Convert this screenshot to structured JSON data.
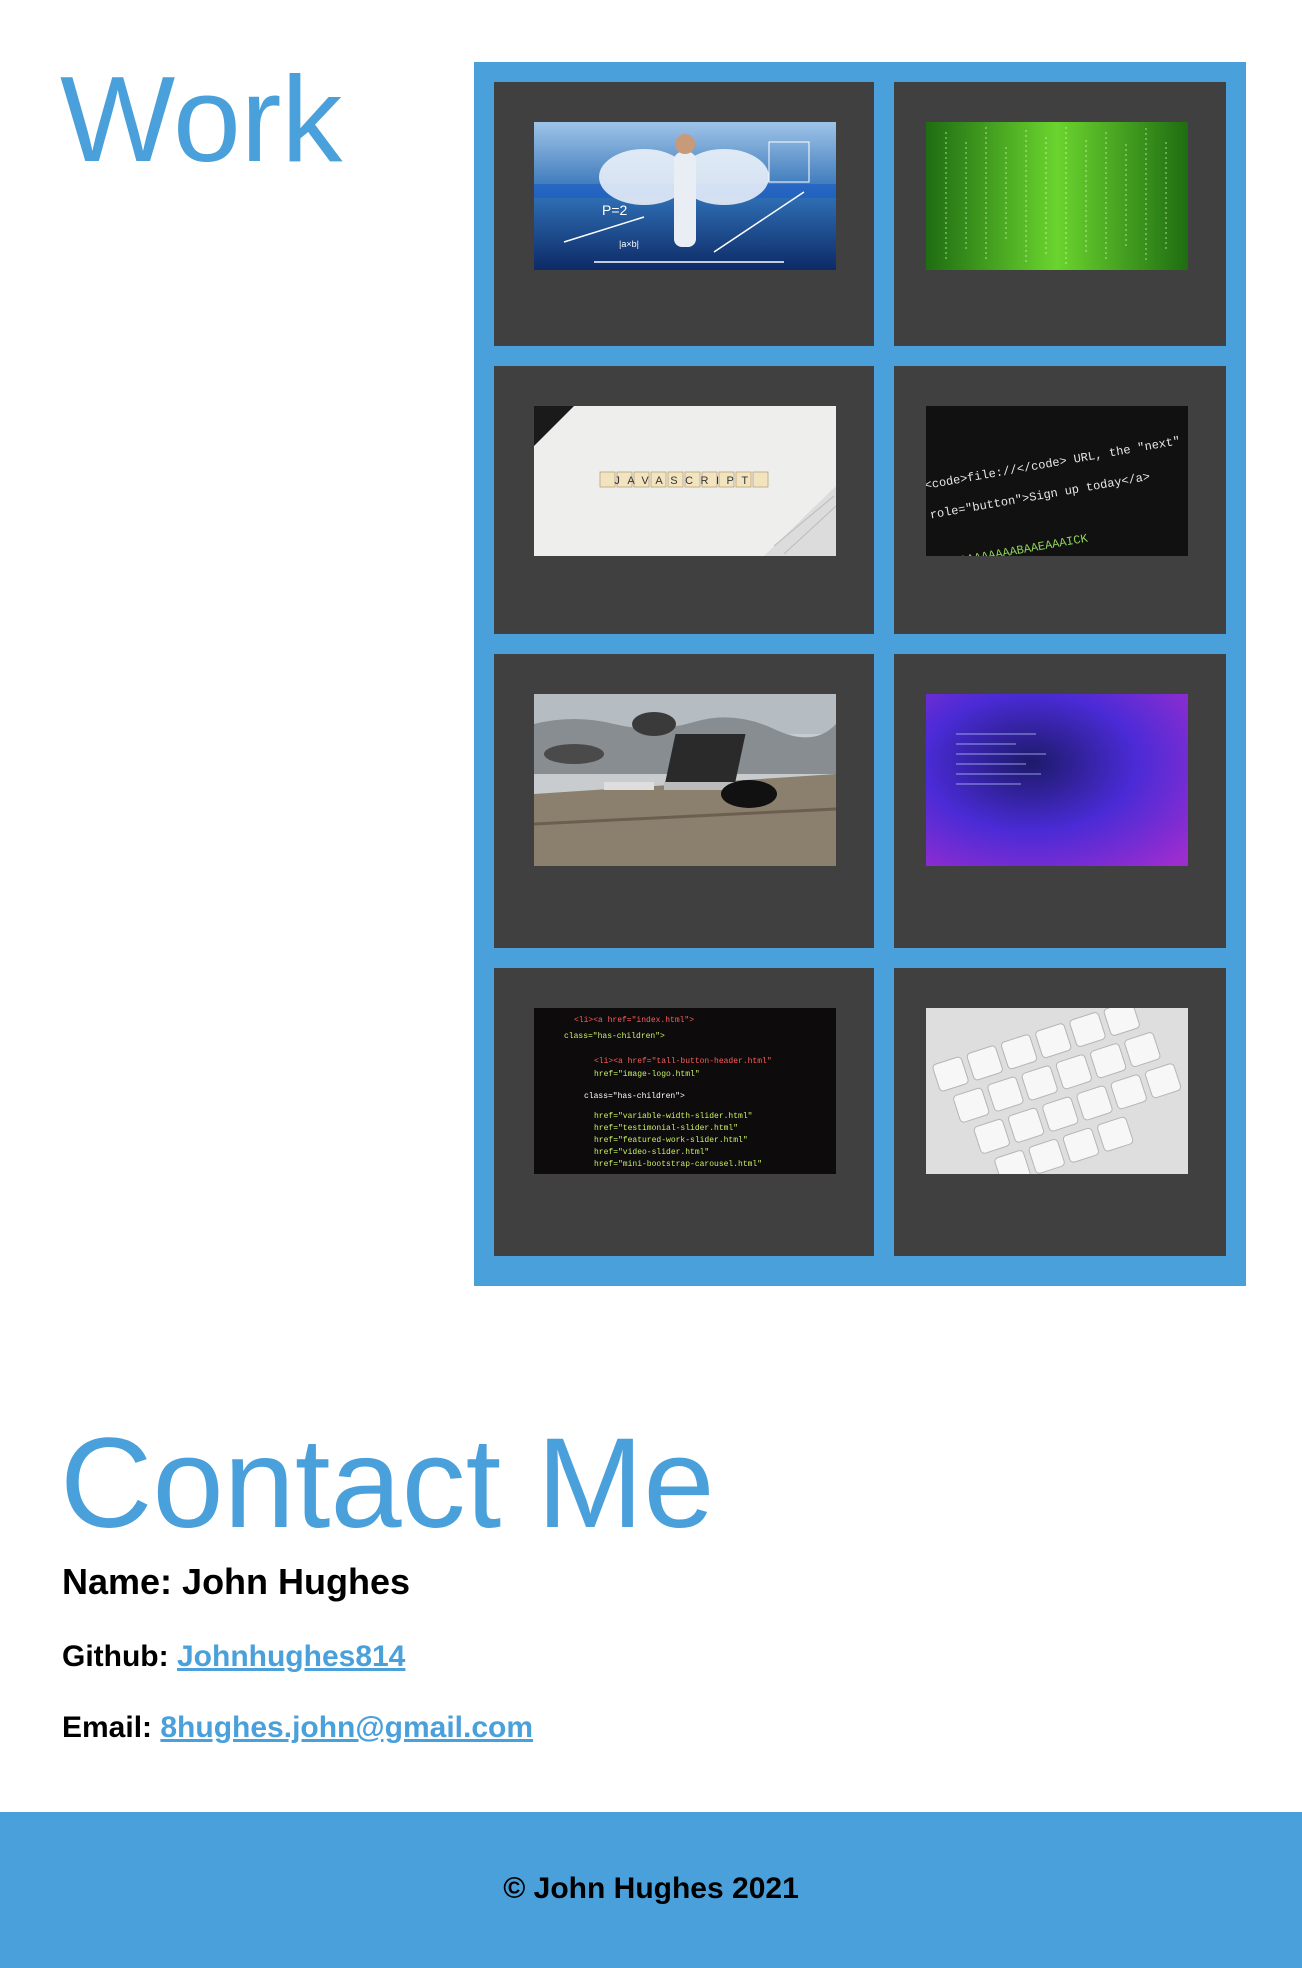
{
  "work": {
    "title": "Work"
  },
  "portfolio": {
    "items": [
      {
        "name": "angel-math-project",
        "alt": "Angel with equations"
      },
      {
        "name": "green-code-rain-project",
        "alt": "Green code rain"
      },
      {
        "name": "javascript-tiles-project",
        "alt": "JAVASCRIPT tiles",
        "tile_text": "JAVASCRIPT"
      },
      {
        "name": "html-code-project",
        "alt": "HTML code on screen",
        "code_lines": [
          "<code>file://</code> URL, the \"next\" a",
          "role=\"button\">Sign up today</a></p>"
        ]
      },
      {
        "name": "laptop-beach-project",
        "alt": "Laptop on beach table"
      },
      {
        "name": "purple-code-project",
        "alt": "Purple code"
      },
      {
        "name": "html-source-project",
        "alt": "HTML source code"
      },
      {
        "name": "keyboard-project",
        "alt": "Keyboard keys"
      }
    ]
  },
  "contact": {
    "title": "Contact Me",
    "name_label": "Name: John Hughes",
    "github_label": "Github:",
    "github_link": "Johnhughes814",
    "email_label": "Email:",
    "email_link": "8hughes.john@gmail.com"
  },
  "footer": {
    "text": "© John Hughes 2021"
  },
  "colors": {
    "accent": "#4aa0da",
    "card": "#404040"
  }
}
